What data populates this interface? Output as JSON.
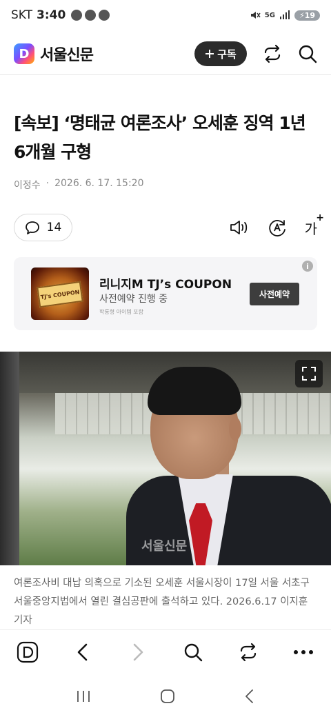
{
  "status_bar": {
    "carrier": "SKT",
    "time": "3:40",
    "network": "5G",
    "battery": "19"
  },
  "header": {
    "logo_letter": "D",
    "logo_text": "서울신문",
    "subscribe_label": "구독"
  },
  "article": {
    "headline": "[속보] ‘명태균 여론조사’ 오세훈 징역 1년 6개월 구형",
    "author": "이정수",
    "separator": "·",
    "datetime": "2026. 6. 17. 15:20",
    "comment_count": "14",
    "font_size_label": "가"
  },
  "ad": {
    "title": "리니지M TJ’s COUPON",
    "subtitle": "사전예약 진행 중",
    "fineprint": "학룡형 아이템 포함",
    "button_label": "사전예약",
    "info_label": "i",
    "image_text": "TJ's COUPON"
  },
  "photo": {
    "watermark": "서울신문",
    "caption": "여론조사비 대납 의혹으로 기소된 오세훈 서울시장이 17일 서울 서초구 서울중앙지법에서 열린 결심공판에 출석하고 있다. 2026.6.17 이지훈 기자"
  },
  "colors": {
    "subscribe_bg": "#2b2b2b",
    "tie": "#c11a24",
    "ad_bg": "#f5f5f7"
  }
}
